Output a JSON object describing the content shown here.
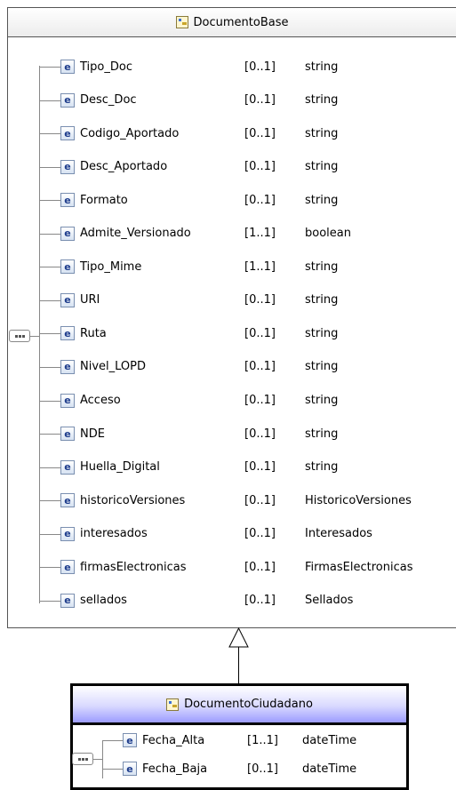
{
  "base_type": {
    "name": "DocumentoBase",
    "elements": [
      {
        "name": "Tipo_Doc",
        "cardinality": "[0..1]",
        "type": "string"
      },
      {
        "name": "Desc_Doc",
        "cardinality": "[0..1]",
        "type": "string"
      },
      {
        "name": "Codigo_Aportado",
        "cardinality": "[0..1]",
        "type": "string"
      },
      {
        "name": "Desc_Aportado",
        "cardinality": "[0..1]",
        "type": "string"
      },
      {
        "name": "Formato",
        "cardinality": "[0..1]",
        "type": "string"
      },
      {
        "name": "Admite_Versionado",
        "cardinality": "[1..1]",
        "type": "boolean"
      },
      {
        "name": "Tipo_Mime",
        "cardinality": "[1..1]",
        "type": "string"
      },
      {
        "name": "URI",
        "cardinality": "[0..1]",
        "type": "string"
      },
      {
        "name": "Ruta",
        "cardinality": "[0..1]",
        "type": "string"
      },
      {
        "name": "Nivel_LOPD",
        "cardinality": "[0..1]",
        "type": "string"
      },
      {
        "name": "Acceso",
        "cardinality": "[0..1]",
        "type": "string"
      },
      {
        "name": "NDE",
        "cardinality": "[0..1]",
        "type": "string"
      },
      {
        "name": "Huella_Digital",
        "cardinality": "[0..1]",
        "type": "string"
      },
      {
        "name": "historicoVersiones",
        "cardinality": "[0..1]",
        "type": "HistoricoVersiones"
      },
      {
        "name": "interesados",
        "cardinality": "[0..1]",
        "type": "Interesados"
      },
      {
        "name": "firmasElectronicas",
        "cardinality": "[0..1]",
        "type": "FirmasElectronicas"
      },
      {
        "name": "sellados",
        "cardinality": "[0..1]",
        "type": "Sellados"
      }
    ]
  },
  "derived_type": {
    "name": "DocumentoCiudadano",
    "elements": [
      {
        "name": "Fecha_Alta",
        "cardinality": "[1..1]",
        "type": "dateTime"
      },
      {
        "name": "Fecha_Baja",
        "cardinality": "[0..1]",
        "type": "dateTime"
      }
    ]
  },
  "icons": {
    "element_glyph": "e",
    "type_icon": "complex-type-icon",
    "compositor": "sequence-icon",
    "relation": "inheritance-arrow-icon"
  },
  "colors": {
    "derived_header": "#9c9cff",
    "element_icon_text": "#1d3c8c"
  }
}
